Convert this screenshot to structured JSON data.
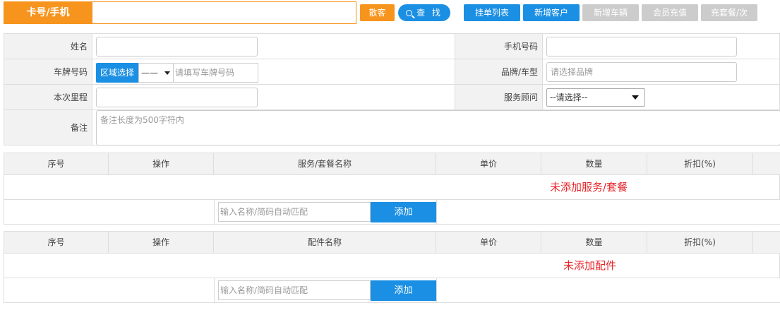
{
  "topbar": {
    "card_label": "卡号/手机",
    "card_value": "",
    "walkin": "散客",
    "search": "查 找",
    "hang_list": "挂单列表",
    "new_customer": "新增客户",
    "new_car": "新增车辆",
    "member_recharge": "会员充值",
    "package_recharge": "充套餐/次"
  },
  "form": {
    "name_label": "姓名",
    "phone_label": "手机号码",
    "plate_label": "车牌号码",
    "region_button": "区域选择",
    "region_value": "——",
    "plate_placeholder": "请填写车牌号码",
    "brand_label": "品牌/车型",
    "brand_placeholder": "请选择品牌",
    "mileage_label": "本次里程",
    "advisor_label": "服务顾问",
    "advisor_value": "--请选择--",
    "remark_label": "备注",
    "remark_placeholder": "备注长度为500字符内"
  },
  "service_table": {
    "headers": [
      "序号",
      "操作",
      "服务/套餐名称",
      "单价",
      "数量",
      "折扣(%)"
    ],
    "empty_text": "未添加服务/套餐",
    "input_placeholder": "输入名称/简码自动匹配",
    "add_button": "添加"
  },
  "parts_table": {
    "headers": [
      "序号",
      "操作",
      "配件名称",
      "单价",
      "数量",
      "折扣(%)"
    ],
    "empty_text": "未添加配件",
    "input_placeholder": "输入名称/简码自动匹配",
    "add_button": "添加"
  },
  "colors": {
    "orange": "#f7941d",
    "blue": "#1a8fe3",
    "disabled": "#cccccc",
    "empty_red": "#e8262a"
  }
}
